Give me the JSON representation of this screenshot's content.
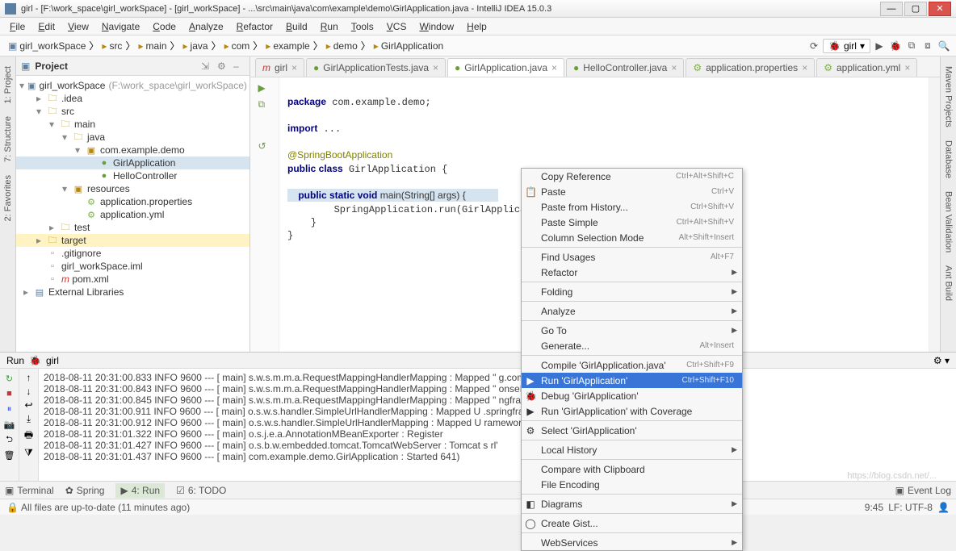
{
  "window": {
    "title": "girl - [F:\\work_space\\girl_workSpace] - [girl_workSpace] - ...\\src\\main\\java\\com\\example\\demo\\GirlApplication.java - IntelliJ IDEA 15.0.3"
  },
  "menu": [
    "File",
    "Edit",
    "View",
    "Navigate",
    "Code",
    "Analyze",
    "Refactor",
    "Build",
    "Run",
    "Tools",
    "VCS",
    "Window",
    "Help"
  ],
  "breadcrumbs": [
    "girl_workSpace",
    "src",
    "main",
    "java",
    "com",
    "example",
    "demo",
    "GirlApplication"
  ],
  "runConfig": "girl",
  "projectPane": {
    "title": "Project",
    "root": {
      "label": "girl_workSpace",
      "sub": "(F:\\work_space\\girl_workSpace)"
    },
    "nodes": [
      {
        "indent": 1,
        "tw": "▸",
        "ic": "folder",
        "label": ".idea"
      },
      {
        "indent": 1,
        "tw": "▾",
        "ic": "folder",
        "label": "src"
      },
      {
        "indent": 2,
        "tw": "▾",
        "ic": "folder",
        "label": "main"
      },
      {
        "indent": 3,
        "tw": "▾",
        "ic": "folder",
        "label": "java"
      },
      {
        "indent": 4,
        "tw": "▾",
        "ic": "pkg",
        "label": "com.example.demo"
      },
      {
        "indent": 5,
        "tw": "",
        "ic": "cls",
        "label": "GirlApplication",
        "sel": true
      },
      {
        "indent": 5,
        "tw": "",
        "ic": "cls",
        "label": "HelloController"
      },
      {
        "indent": 3,
        "tw": "▾",
        "ic": "pkg",
        "label": "resources"
      },
      {
        "indent": 4,
        "tw": "",
        "ic": "prop",
        "label": "application.properties"
      },
      {
        "indent": 4,
        "tw": "",
        "ic": "prop",
        "label": "application.yml"
      },
      {
        "indent": 2,
        "tw": "▸",
        "ic": "folder",
        "label": "test"
      },
      {
        "indent": 1,
        "tw": "▸",
        "ic": "folder",
        "label": "target",
        "hl": true
      },
      {
        "indent": 1,
        "tw": "",
        "ic": "file",
        "label": ".gitignore"
      },
      {
        "indent": 1,
        "tw": "",
        "ic": "file",
        "label": "girl_workSpace.iml"
      },
      {
        "indent": 1,
        "tw": "",
        "ic": "file",
        "label": "pom.xml",
        "m": true
      },
      {
        "indent": 0,
        "tw": "▸",
        "ic": "mod",
        "label": "External Libraries"
      }
    ]
  },
  "tabs": [
    {
      "label": "girl",
      "ic": "m"
    },
    {
      "label": "GirlApplicationTests.java",
      "ic": "cls"
    },
    {
      "label": "GirlApplication.java",
      "ic": "cls",
      "active": true
    },
    {
      "label": "HelloController.java",
      "ic": "cls"
    },
    {
      "label": "application.properties",
      "ic": "prop"
    },
    {
      "label": "application.yml",
      "ic": "prop"
    }
  ],
  "code": {
    "l1": "package com.example.demo;",
    "l2": "import ...",
    "l3": "@SpringBootApplication",
    "l4": "public class GirlApplication {",
    "l5": "    public static void main(String[] args) {",
    "l6": "        SpringApplication.run(GirlApplication.class, args);",
    "l7": "    }",
    "l8": "}"
  },
  "context": [
    {
      "label": "Copy Reference",
      "sc": "Ctrl+Alt+Shift+C"
    },
    {
      "label": "Paste",
      "sc": "Ctrl+V",
      "ic": "📋"
    },
    {
      "label": "Paste from History...",
      "sc": "Ctrl+Shift+V"
    },
    {
      "label": "Paste Simple",
      "sc": "Ctrl+Alt+Shift+V"
    },
    {
      "label": "Column Selection Mode",
      "sc": "Alt+Shift+Insert"
    },
    {
      "sep": true
    },
    {
      "label": "Find Usages",
      "sc": "Alt+F7"
    },
    {
      "label": "Refactor",
      "arr": true
    },
    {
      "sep": true
    },
    {
      "label": "Folding",
      "arr": true
    },
    {
      "sep": true
    },
    {
      "label": "Analyze",
      "arr": true
    },
    {
      "sep": true
    },
    {
      "label": "Go To",
      "arr": true
    },
    {
      "label": "Generate...",
      "sc": "Alt+Insert"
    },
    {
      "sep": true
    },
    {
      "label": "Compile 'GirlApplication.java'",
      "sc": "Ctrl+Shift+F9"
    },
    {
      "label": "Run 'GirlApplication'",
      "sc": "Ctrl+Shift+F10",
      "ic": "▶",
      "hov": true
    },
    {
      "label": "Debug 'GirlApplication'",
      "ic": "🐞"
    },
    {
      "label": "Run 'GirlApplication' with Coverage",
      "ic": "▶"
    },
    {
      "sep": true
    },
    {
      "label": "Select 'GirlApplication'",
      "ic": "⚙"
    },
    {
      "sep": true
    },
    {
      "label": "Local History",
      "arr": true
    },
    {
      "sep": true
    },
    {
      "label": "Compare with Clipboard"
    },
    {
      "label": "File Encoding"
    },
    {
      "sep": true
    },
    {
      "label": "Diagrams",
      "arr": true,
      "ic": "◧"
    },
    {
      "sep": true
    },
    {
      "label": "Create Gist...",
      "ic": "◯"
    },
    {
      "sep": true
    },
    {
      "label": "WebServices",
      "arr": true
    }
  ],
  "sideLeft": [
    "1: Project",
    "7: Structure",
    "2: Favorites"
  ],
  "sideRight": [
    "Maven Projects",
    "Database",
    "Bean Validation",
    "Ant Build"
  ],
  "runHeader": {
    "label": "Run",
    "cfg": "girl"
  },
  "console": [
    "2018-08-11 20:31:00.833  INFO 9600 --- [           main] s.w.s.m.m.a.RequestMappingHandlerMapping : Mapped \"                                             g.com.example.demo.HelloController.say()",
    "2018-08-11 20:31:00.843  INFO 9600 --- [           main] s.w.s.m.m.a.RequestMappingHandlerMapping : Mapped \"                                             onseEntity<java.util.Map<java.lang.String, ja",
    "2018-08-11 20:31:00.845  INFO 9600 --- [           main] s.w.s.m.m.a.RequestMappingHandlerMapping : Mapped \"                                             ngframework.web.servlet.ModelAndView org.spri",
    "2018-08-11 20:31:00.911  INFO 9600 --- [           main] o.s.w.s.handler.SimpleUrlHandlerMapping  : Mapped U                                             .springframework.web.servlet.resource.Resourc",
    "2018-08-11 20:31:00.912  INFO 9600 --- [           main] o.s.w.s.handler.SimpleUrlHandlerMapping  : Mapped U                                             ramework.web.servlet.resource.ResourceHttpReq",
    "2018-08-11 20:31:01.322  INFO 9600 --- [           main] o.s.j.e.a.AnnotationMBeanExporter        : Register",
    "2018-08-11 20:31:01.427  INFO 9600 --- [           main] o.s.b.w.embedded.tomcat.TomcatWebServer  : Tomcat s                                             rl'",
    "2018-08-11 20:31:01.437  INFO 9600 --- [           main] com.example.demo.GirlApplication         : Started                                              641)"
  ],
  "bottomTabs": [
    {
      "label": "Terminal",
      "ic": "▣"
    },
    {
      "label": "Spring",
      "ic": "✿"
    },
    {
      "label": "4: Run",
      "ic": "▶",
      "active": true
    },
    {
      "label": "6: TODO",
      "ic": "☑"
    }
  ],
  "eventLog": "Event Log",
  "status": {
    "msg": "All files are up-to-date (11 minutes ago)",
    "pos": "9:45",
    "enc": "LF: UTF-8"
  },
  "watermark": "https://blog.csdn.net/..."
}
